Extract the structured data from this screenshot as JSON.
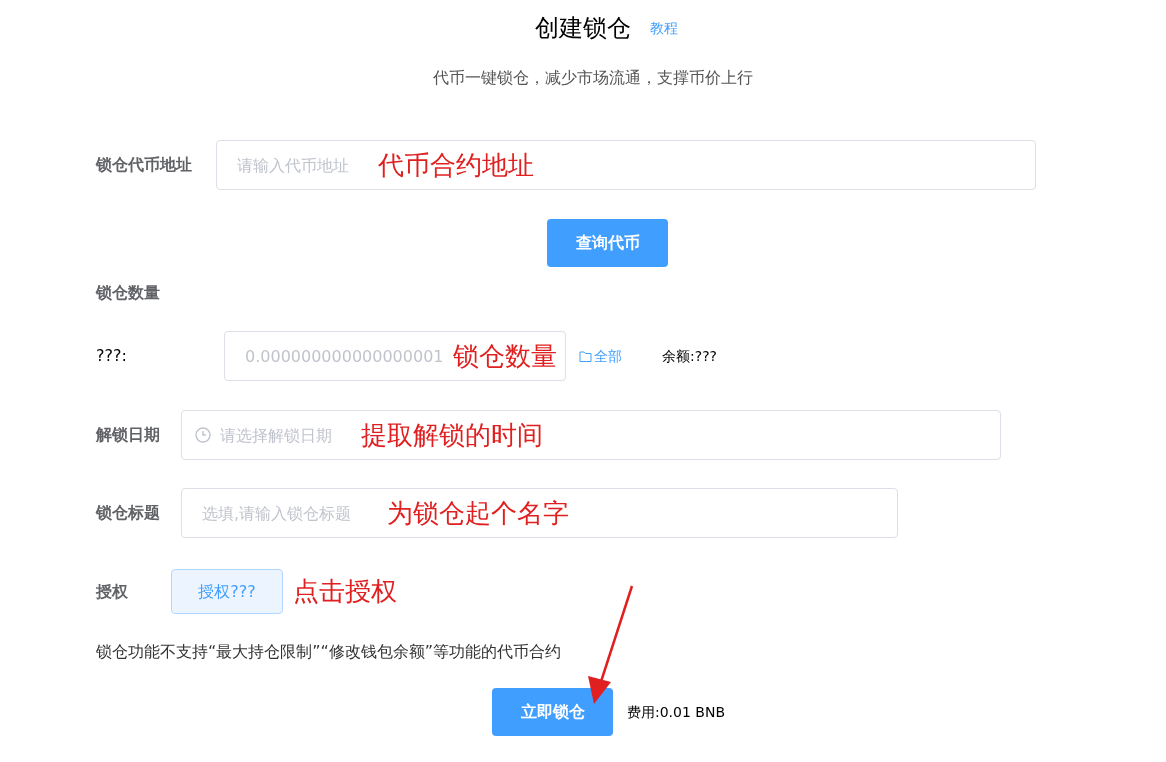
{
  "header": {
    "title": "创建锁仓",
    "tutorial_link": "教程"
  },
  "subtitle": "代币一键锁仓，减少市场流通，支撑币价上行",
  "token_address": {
    "label": "锁仓代币地址",
    "placeholder": "请输入代币地址",
    "annotation": "代币合约地址"
  },
  "query_button": "查询代币",
  "amount": {
    "heading": "锁仓数量",
    "token_label": "???:",
    "placeholder": "0.000000000000000001",
    "annotation": "锁仓数量",
    "all_link": "全部",
    "balance": "余额:???"
  },
  "unlock_date": {
    "label": "解锁日期",
    "placeholder": "请选择解锁日期",
    "annotation": "提取解锁的时间"
  },
  "lock_title": {
    "label": "锁仓标题",
    "placeholder": "选填,请输入锁仓标题",
    "annotation": "为锁仓起个名字"
  },
  "authorize": {
    "label": "授权",
    "button": "授权???",
    "annotation": "点击授权"
  },
  "notice": "锁仓功能不支持“最大持仓限制”“修改钱包余额”等功能的代币合约",
  "submit_button": "立即锁仓",
  "fee": "费用:0.01 BNB"
}
